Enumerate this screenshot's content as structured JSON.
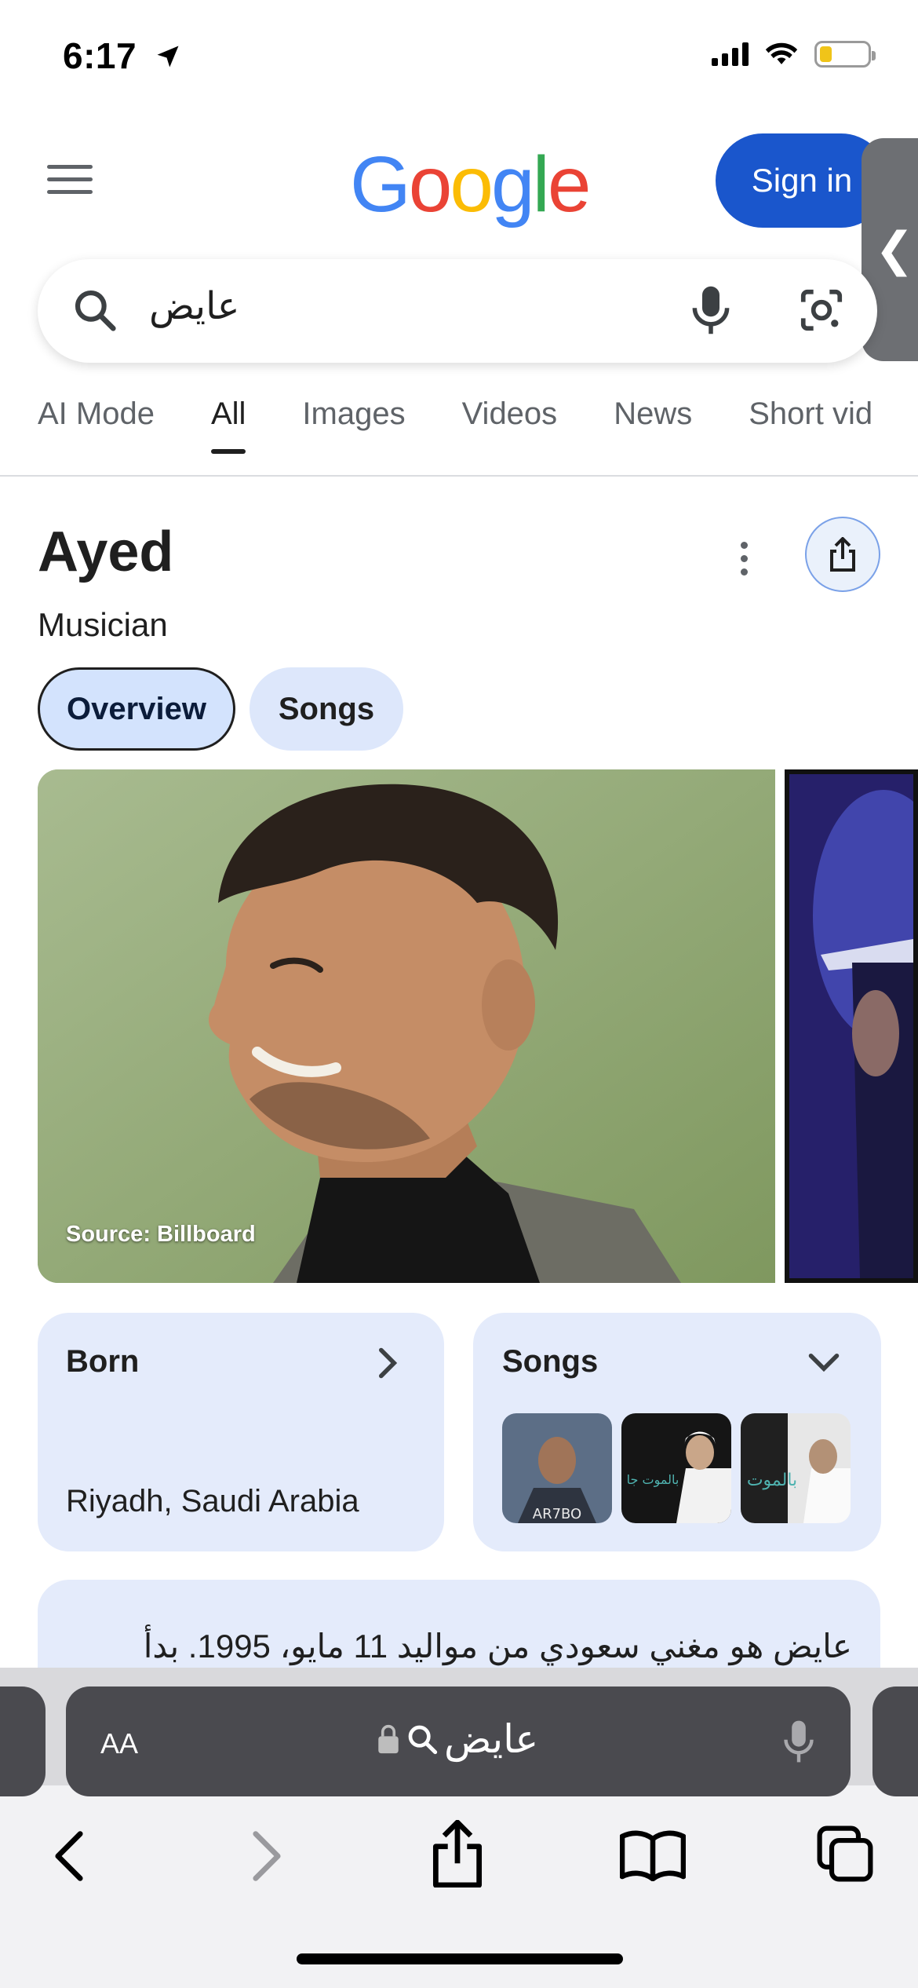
{
  "status_bar": {
    "time": "6:17",
    "battery_level": 0.25
  },
  "header": {
    "logo_text": "Google",
    "logo_colors": [
      "#4285F4",
      "#EA4335",
      "#FBBC05",
      "#4285F4",
      "#34A853",
      "#EA4335"
    ],
    "sign_in_label": "Sign in",
    "side_tab_glyph": "❮"
  },
  "search": {
    "query": "عايض"
  },
  "tabs": [
    {
      "label": "AI Mode"
    },
    {
      "label": "All"
    },
    {
      "label": "Images"
    },
    {
      "label": "Videos"
    },
    {
      "label": "News"
    },
    {
      "label": "Short vid"
    }
  ],
  "knowledge_panel": {
    "title": "Ayed",
    "subtitle": "Musician",
    "chips": {
      "overview": "Overview",
      "songs": "Songs"
    },
    "photo_caption": "Source: Billboard",
    "born_card": {
      "title": "Born",
      "value": "Riyadh, Saudi Arabia"
    },
    "songs_card": {
      "title": "Songs",
      "thumb_labels": [
        "AR7BO",
        "بالموت جا",
        "بالموت"
      ]
    },
    "description": "عايض هو مغني سعودي من مواليد 11 مايو، 1995. بدأ"
  },
  "safari": {
    "aa_label": "AA",
    "url_text": "عايض"
  },
  "colors": {
    "accent_blue": "#1a56cc",
    "card_bg": "#e4ebfb",
    "chip_active_bg": "#d3e3fd"
  }
}
